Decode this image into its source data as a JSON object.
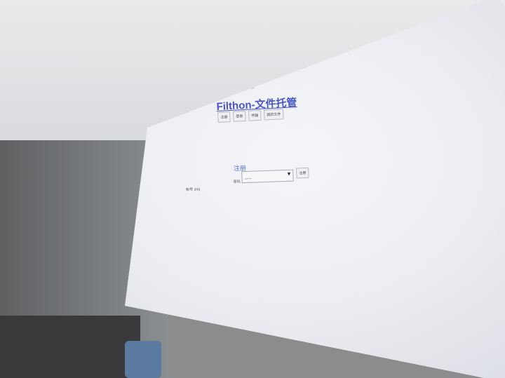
{
  "window_title": "Filthon-文件",
  "app": {
    "title": "Filthon-文件托管",
    "nav_buttons": [
      "注册",
      "登录",
      "传输",
      "我的文件"
    ]
  },
  "login": {
    "heading": "注册",
    "account_label": "账号 ziiq",
    "select_label": "密码",
    "select_value": "一一",
    "select_arrow": "▼",
    "submit_label": "注册"
  },
  "colors": {
    "link": "#4a56c6",
    "screen_bg": "#eceef3"
  },
  "icons": {
    "camera": "camera-icon"
  }
}
